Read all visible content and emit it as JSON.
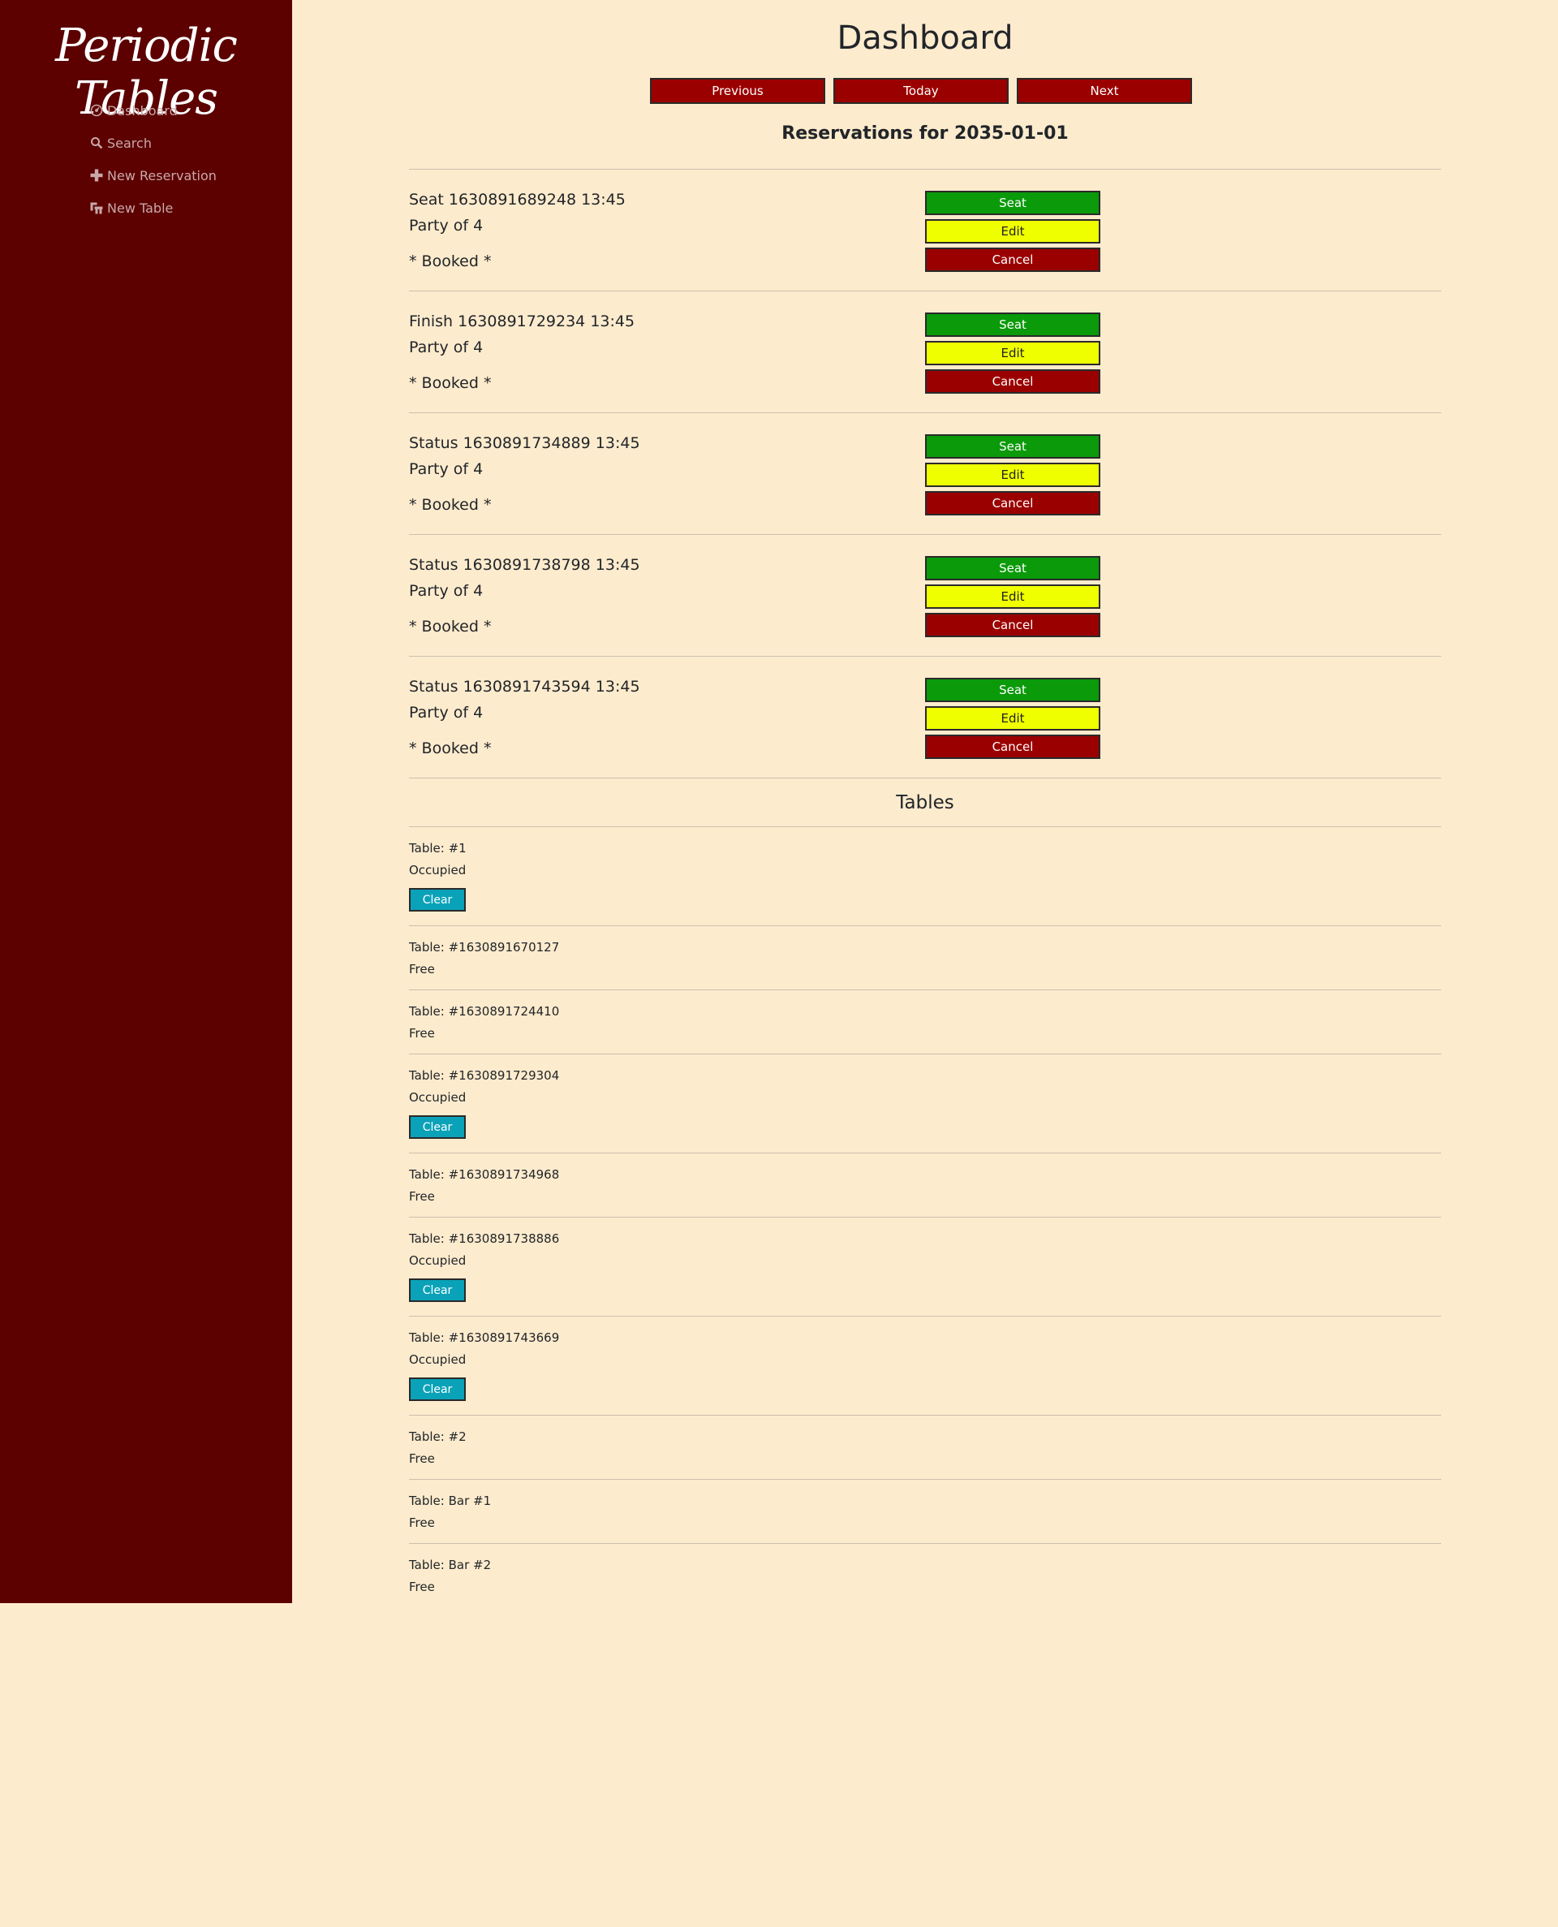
{
  "sidebar": {
    "brand": "Periodic Tables",
    "items": [
      {
        "label": "Dashboard",
        "icon": "dashboard-icon"
      },
      {
        "label": "Search",
        "icon": "search-icon"
      },
      {
        "label": "New Reservation",
        "icon": "plus-icon"
      },
      {
        "label": "New Table",
        "icon": "table-icon"
      }
    ]
  },
  "header": {
    "title": "Dashboard",
    "previous_label": "Previous",
    "today_label": "Today",
    "next_label": "Next",
    "reservations_heading": "Reservations for 2035-01-01"
  },
  "reservations": [
    {
      "name_time": "Seat 1630891689248 13:45",
      "party": "Party of 4",
      "status": "* Booked *",
      "seat_label": "Seat",
      "edit_label": "Edit",
      "cancel_label": "Cancel"
    },
    {
      "name_time": "Finish 1630891729234 13:45",
      "party": "Party of 4",
      "status": "* Booked *",
      "seat_label": "Seat",
      "edit_label": "Edit",
      "cancel_label": "Cancel"
    },
    {
      "name_time": "Status 1630891734889 13:45",
      "party": "Party of 4",
      "status": "* Booked *",
      "seat_label": "Seat",
      "edit_label": "Edit",
      "cancel_label": "Cancel"
    },
    {
      "name_time": "Status 1630891738798 13:45",
      "party": "Party of 4",
      "status": "* Booked *",
      "seat_label": "Seat",
      "edit_label": "Edit",
      "cancel_label": "Cancel"
    },
    {
      "name_time": "Status 1630891743594 13:45",
      "party": "Party of 4",
      "status": "* Booked *",
      "seat_label": "Seat",
      "edit_label": "Edit",
      "cancel_label": "Cancel"
    }
  ],
  "tables_heading": "Tables",
  "tables": [
    {
      "name": "Table: #1",
      "status": "Occupied",
      "clear_label": "Clear"
    },
    {
      "name": "Table: #1630891670127",
      "status": "Free"
    },
    {
      "name": "Table: #1630891724410",
      "status": "Free"
    },
    {
      "name": "Table: #1630891729304",
      "status": "Occupied",
      "clear_label": "Clear"
    },
    {
      "name": "Table: #1630891734968",
      "status": "Free"
    },
    {
      "name": "Table: #1630891738886",
      "status": "Occupied",
      "clear_label": "Clear"
    },
    {
      "name": "Table: #1630891743669",
      "status": "Occupied",
      "clear_label": "Clear"
    },
    {
      "name": "Table: #2",
      "status": "Free"
    },
    {
      "name": "Table: Bar #1",
      "status": "Free"
    },
    {
      "name": "Table: Bar #2",
      "status": "Free"
    }
  ],
  "colors": {
    "page_bg": "#fdebcd",
    "sidebar_bg": "#5c0000",
    "button_red": "#9b0000",
    "button_green": "#0a9a0a",
    "button_yellow": "#f0ff00",
    "button_teal": "#0aa2b8"
  }
}
